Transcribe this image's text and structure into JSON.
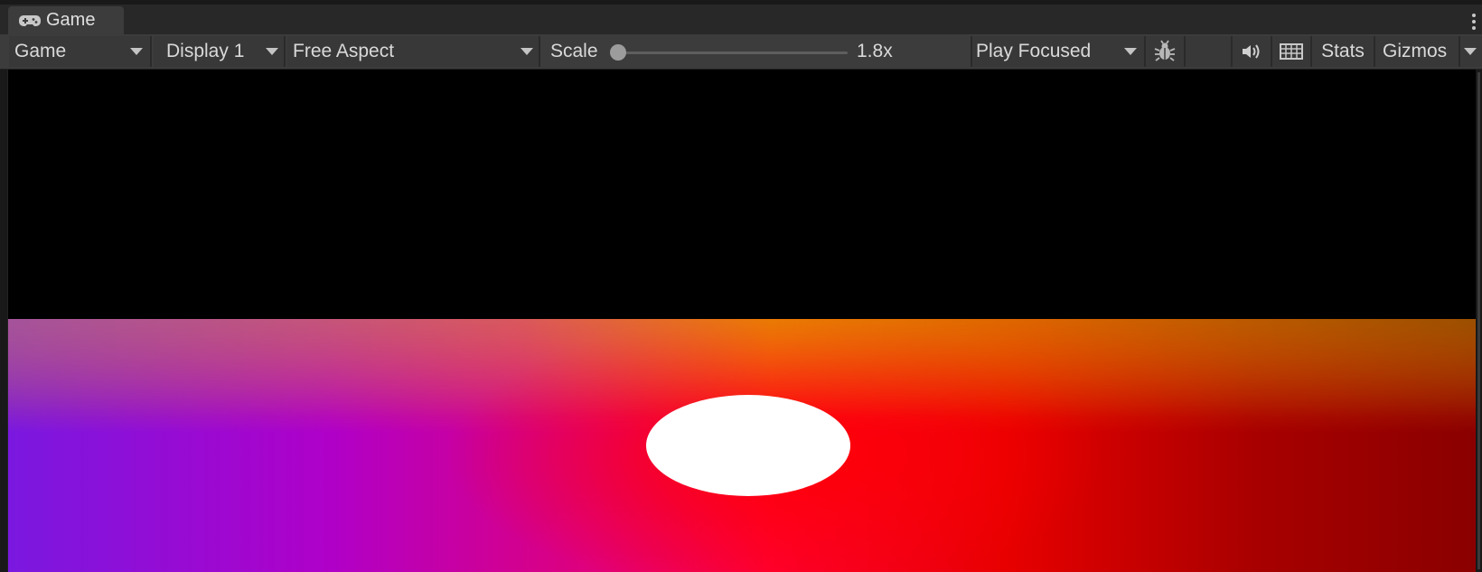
{
  "window": {
    "tab": {
      "label": "Game",
      "icon": "gamepad-icon"
    },
    "menu_icon": "kebab-menu-icon"
  },
  "toolbar": {
    "game_view_select": "Game",
    "display_select": "Display 1",
    "aspect_select": "Free Aspect",
    "scale_label": "Scale",
    "scale_value": "1.8x",
    "play_mode_select": "Play Focused",
    "debug_icon": "bug-icon",
    "mute_icon": "speaker-icon",
    "shortcuts_icon": "keyboard-icon",
    "stats_label": "Stats",
    "gizmos_label": "Gizmos"
  },
  "colors": {
    "panel_bg": "#3c3c3c",
    "tab_bar_bg": "#282828",
    "viewport_bg": "#000000",
    "sun": "#ffffff"
  },
  "scale_slider_level": 0.0
}
